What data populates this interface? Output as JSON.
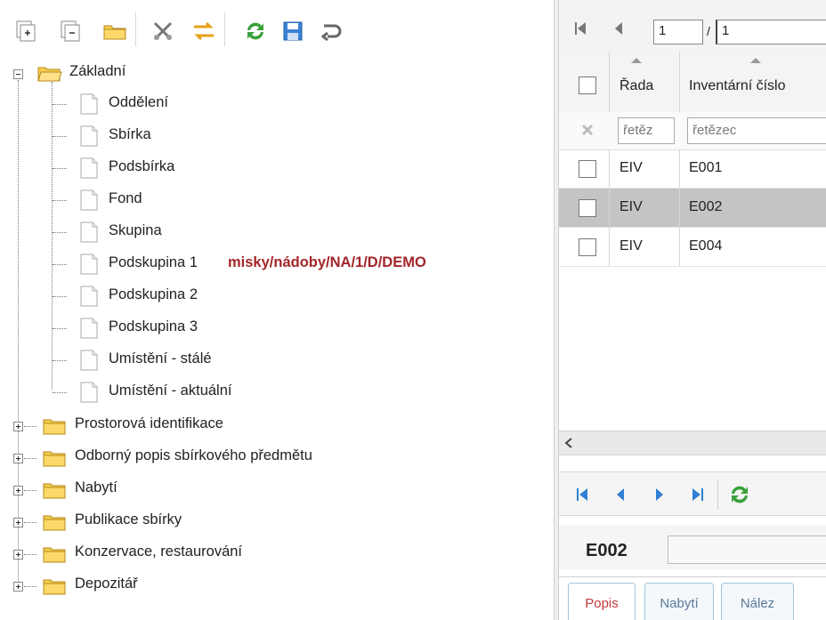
{
  "tree": {
    "root": {
      "label": "Základní",
      "expanded": true
    },
    "children": [
      {
        "label": "Oddělení"
      },
      {
        "label": "Sbírka"
      },
      {
        "label": "Podsbírka"
      },
      {
        "label": "Fond"
      },
      {
        "label": "Skupina"
      },
      {
        "label": "Podskupina 1",
        "value": "misky/nádoby/NA/1/D/DEMO"
      },
      {
        "label": "Podskupina 2"
      },
      {
        "label": "Podskupina 3"
      },
      {
        "label": "Umístění - stálé"
      },
      {
        "label": "Umístění - aktuální"
      }
    ],
    "collapsed": [
      {
        "label": "Prostorová identifikace"
      },
      {
        "label": "Odborný popis sbírkového předmětu"
      },
      {
        "label": "Nabytí"
      },
      {
        "label": "Publikace sbírky"
      },
      {
        "label": "Konzervace, restaurování"
      },
      {
        "label": "Depozitář"
      }
    ]
  },
  "pager": {
    "page": "1",
    "total": "1",
    "separator": "/"
  },
  "grid": {
    "columns": [
      {
        "label": "Řada"
      },
      {
        "label": "Inventární číslo"
      }
    ],
    "filters": [
      "řetěz",
      "řetězec"
    ],
    "rows": [
      {
        "rada": "EIV",
        "cislo": "E001",
        "selected": false
      },
      {
        "rada": "EIV",
        "cislo": "E002",
        "selected": true
      },
      {
        "rada": "EIV",
        "cislo": "E004",
        "selected": false
      }
    ]
  },
  "detail": {
    "code": "E002"
  },
  "tabs": [
    {
      "label": "Popis",
      "active": true
    },
    {
      "label": "Nabytí",
      "active": false
    },
    {
      "label": "Nález",
      "active": false
    }
  ],
  "colors": {
    "highlight": "#a3262a",
    "selected_row": "#c4c4c4",
    "active_tab": "#c23a3a",
    "tab_text": "#5a7a9a"
  }
}
